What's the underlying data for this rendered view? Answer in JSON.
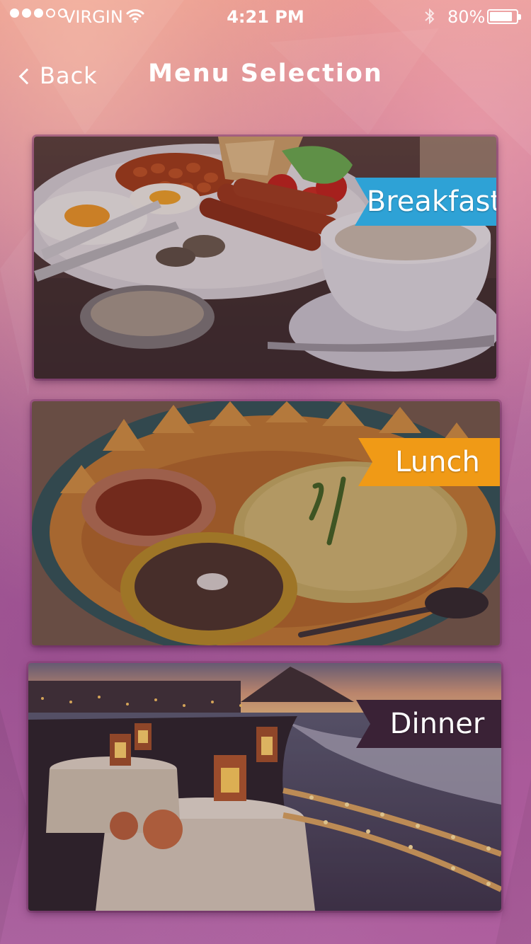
{
  "status_bar": {
    "carrier": "VIRGIN",
    "time": "4:21 PM",
    "battery": "80%",
    "signal_bars_filled": 3,
    "signal_bars_total": 5
  },
  "nav": {
    "back_label": "Back",
    "title": "Menu Selection"
  },
  "menu": [
    {
      "label": "Breakfast",
      "color": "#2ea2d6"
    },
    {
      "label": "Lunch",
      "color": "#f09a16"
    },
    {
      "label": "Dinner",
      "color": "#3a2236"
    }
  ],
  "icons": [
    "wifi-icon",
    "bluetooth-icon",
    "battery-icon",
    "back-chevron-icon"
  ]
}
